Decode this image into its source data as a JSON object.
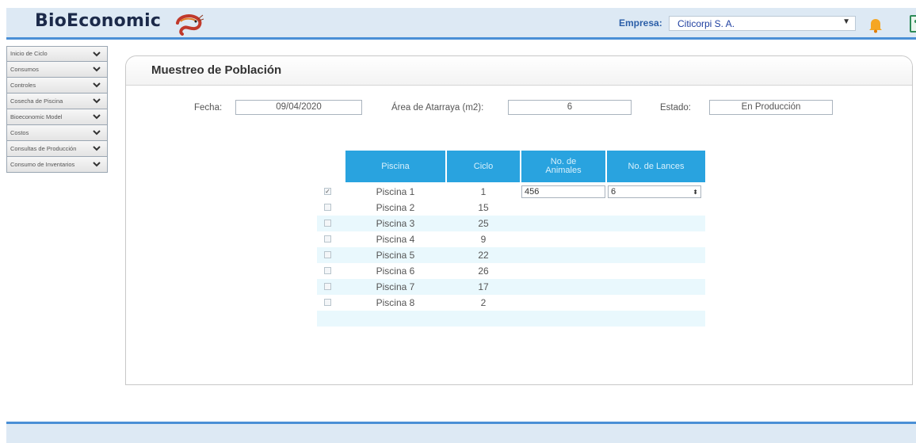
{
  "header": {
    "logo": "BioEconomic",
    "empresa_label": "Empresa:",
    "empresa_value": "Citicorpi S. A."
  },
  "sidebar": {
    "items": [
      {
        "label": "Inicio de Ciclo"
      },
      {
        "label": "Consumos"
      },
      {
        "label": "Controles"
      },
      {
        "label": "Cosecha de Piscina"
      },
      {
        "label": "Bioeconomic Model"
      },
      {
        "label": "Costos"
      },
      {
        "label": "Consultas de Producción"
      },
      {
        "label": "Consumo de Inventarios"
      }
    ]
  },
  "main": {
    "title": "Muestreo de Población",
    "fecha_label": "Fecha:",
    "fecha_value": "09/04/2020",
    "area_label": "Área de Atarraya (m2):",
    "area_value": "6",
    "estado_label": "Estado:",
    "estado_value": "En Producción"
  },
  "table": {
    "headers": [
      "Piscina",
      "Ciclo",
      "No. de Animales",
      "No. de Lances"
    ],
    "rows": [
      {
        "checked": "✓",
        "piscina": "Piscina 1",
        "ciclo": "1",
        "animales": "456",
        "lances": "6"
      },
      {
        "checked": "",
        "piscina": "Piscina 2",
        "ciclo": "15"
      },
      {
        "checked": "",
        "piscina": "Piscina 3",
        "ciclo": "25"
      },
      {
        "checked": "",
        "piscina": "Piscina 4",
        "ciclo": "9"
      },
      {
        "checked": "",
        "piscina": "Piscina 5",
        "ciclo": "22"
      },
      {
        "checked": "",
        "piscina": "Piscina 6",
        "ciclo": "26"
      },
      {
        "checked": "",
        "piscina": "Piscina 7",
        "ciclo": "17"
      },
      {
        "checked": "",
        "piscina": "Piscina 8",
        "ciclo": "2"
      }
    ]
  },
  "colors": {
    "accent": "#4a8fd6",
    "header_bg": "#dde9f4",
    "table_header": "#29a3df",
    "row_alt": "#e9f8fd"
  },
  "icons": [
    "shrimp-logo-icon",
    "dropdown-arrow-icon",
    "notification-bell-icon",
    "user-icon",
    "chevron-down-icon",
    "checkbox-icon",
    "select-spinner-icon"
  ]
}
